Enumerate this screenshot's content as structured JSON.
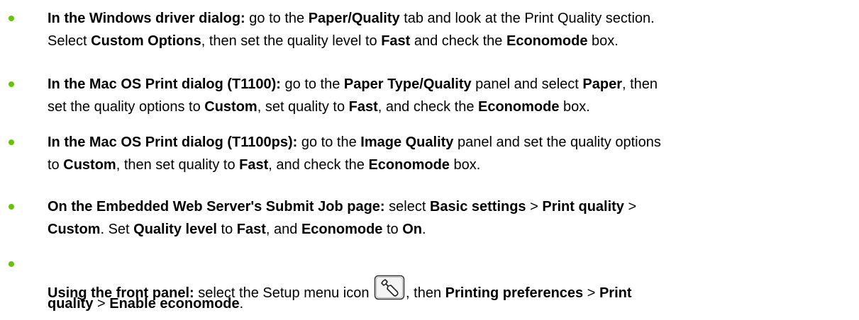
{
  "steps": [
    {
      "line1": [
        {
          "t": "In the Windows driver dialog:",
          "b": true
        },
        {
          "t": " go to the ",
          "b": false
        },
        {
          "t": "Paper/Quality",
          "b": true
        },
        {
          "t": " tab and look at the Print Quality section.",
          "b": false
        }
      ],
      "line2": [
        {
          "t": "Select ",
          "b": false
        },
        {
          "t": "Custom Options",
          "b": true
        },
        {
          "t": ", then set the quality level to ",
          "b": false
        },
        {
          "t": "Fast",
          "b": true
        },
        {
          "t": " and check the ",
          "b": false
        },
        {
          "t": "Economode",
          "b": true
        },
        {
          "t": " box.",
          "b": false
        }
      ]
    },
    {
      "line1": [
        {
          "t": "In the Mac OS Print dialog (T1100):",
          "b": true
        },
        {
          "t": " go to the ",
          "b": false
        },
        {
          "t": "Paper Type/Quality",
          "b": true
        },
        {
          "t": " panel and select ",
          "b": false
        },
        {
          "t": "Paper",
          "b": true
        },
        {
          "t": ", then",
          "b": false
        }
      ],
      "line2": [
        {
          "t": "set the quality options to ",
          "b": false
        },
        {
          "t": "Custom",
          "b": true
        },
        {
          "t": ", set quality to ",
          "b": false
        },
        {
          "t": "Fast",
          "b": true
        },
        {
          "t": ", and check the ",
          "b": false
        },
        {
          "t": "Economode",
          "b": true
        },
        {
          "t": " box.",
          "b": false
        }
      ]
    },
    {
      "line1": [
        {
          "t": "In the Mac OS Print dialog (T1100ps):",
          "b": true
        },
        {
          "t": " go to the ",
          "b": false
        },
        {
          "t": "Image Quality",
          "b": true
        },
        {
          "t": " panel and set the quality options",
          "b": false
        }
      ],
      "line2": [
        {
          "t": "to ",
          "b": false
        },
        {
          "t": "Custom",
          "b": true
        },
        {
          "t": ", then set quality to ",
          "b": false
        },
        {
          "t": "Fast",
          "b": true
        },
        {
          "t": ", and check the ",
          "b": false
        },
        {
          "t": "Economode",
          "b": true
        },
        {
          "t": " box.",
          "b": false
        }
      ]
    },
    {
      "line1": [
        {
          "t": "On the Embedded Web Server's Submit Job page:",
          "b": true
        },
        {
          "t": " select ",
          "b": false
        },
        {
          "t": "Basic settings",
          "b": true
        },
        {
          "t": " > ",
          "b": false
        },
        {
          "t": "Print quality",
          "b": true
        },
        {
          "t": " >",
          "b": false
        }
      ],
      "line2": [
        {
          "t": "Custom",
          "b": true
        },
        {
          "t": ". Set ",
          "b": false
        },
        {
          "t": "Quality level",
          "b": true
        },
        {
          "t": " to ",
          "b": false
        },
        {
          "t": "Fast",
          "b": true
        },
        {
          "t": ", and ",
          "b": false
        },
        {
          "t": "Economode",
          "b": true
        },
        {
          "t": " to ",
          "b": false
        },
        {
          "t": "On",
          "b": true
        },
        {
          "t": ".",
          "b": false
        }
      ]
    },
    {
      "line1": [
        {
          "t": "Using the front panel:",
          "b": true
        },
        {
          "t": " select the Setup menu icon ",
          "b": false
        },
        {
          "icon": "wrench-icon"
        },
        {
          "t": ", then ",
          "b": false
        },
        {
          "t": "Printing preferences",
          "b": true
        },
        {
          "t": " > ",
          "b": false
        },
        {
          "t": "Print",
          "b": true
        }
      ],
      "line2": [
        {
          "t": "quality",
          "b": true
        },
        {
          "t": " > ",
          "b": false
        },
        {
          "t": "Enable economode",
          "b": true
        },
        {
          "t": ".",
          "b": false
        }
      ]
    }
  ],
  "colors": {
    "bullet": "#66c400",
    "text": "#000000"
  }
}
